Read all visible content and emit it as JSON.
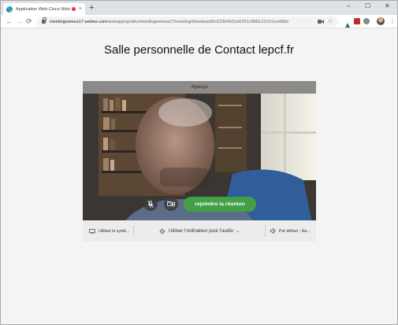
{
  "browser": {
    "tab": {
      "title": "Application Web Cisco Web",
      "close_glyph": "×"
    },
    "newtab_glyph": "+",
    "window_controls": {
      "minimize": "–",
      "maximize": "☐",
      "close": "✕"
    },
    "nav": {
      "back": "←",
      "forward": "→",
      "reload": "⟳"
    },
    "url": {
      "host": "meetingsemea17.webex.com",
      "path": "/webappng/sites/meetingsemea17/meeting/download/0c623b4931e6751c58f2c15101ced0b0"
    },
    "omnibox_icons": [
      "video-camera-icon",
      "star-icon"
    ],
    "extensions": [
      {
        "name": "extension-green-icon",
        "color": "#1b7f5c"
      },
      {
        "name": "extension-pdf-icon",
        "color": "#c62828"
      },
      {
        "name": "extension-gray-icon",
        "color": "#757575"
      }
    ],
    "menu_glyph": "⋮"
  },
  "page": {
    "title": "Salle personnelle de Contact lepcf.fr"
  },
  "preview": {
    "label": "Aperçu",
    "join_label": "rejoindre la réunion",
    "mute_icon": "microphone-muted-icon",
    "video_icon": "video-off-icon",
    "accent": "#43a047"
  },
  "bottom_bar": {
    "system_label": "Utiliser le systè...",
    "audio_label": "Utiliser l'ordinateur pour l'audio",
    "audio_chevron": "⌄",
    "speaker_label": "Par défaut - Ha..."
  }
}
